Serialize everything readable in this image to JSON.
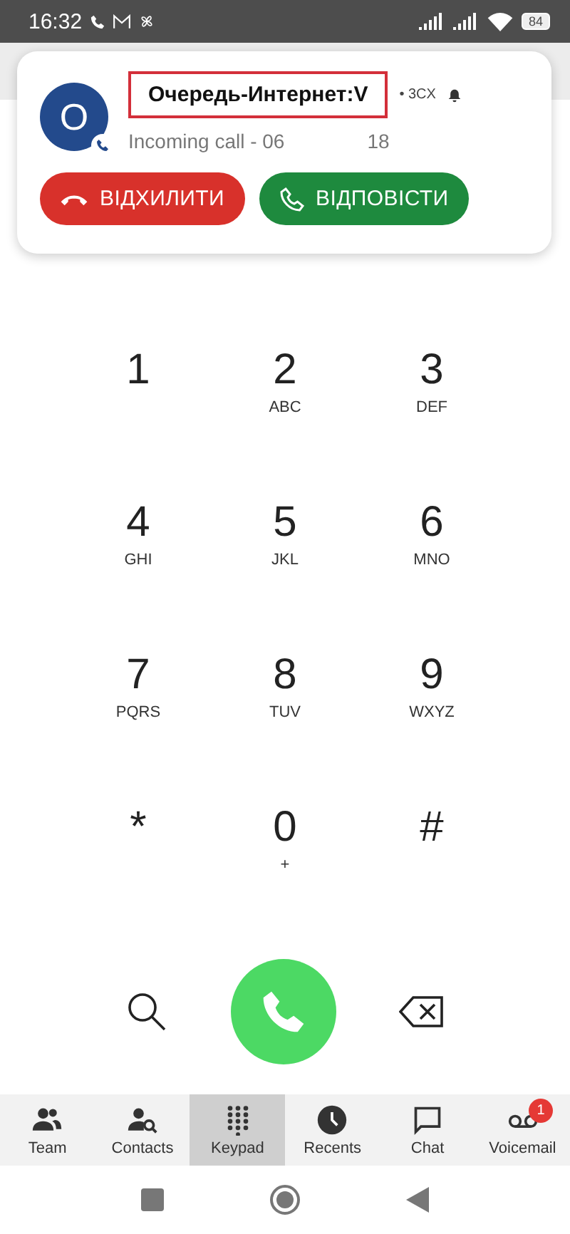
{
  "status_bar": {
    "time": "16:32",
    "battery": "84"
  },
  "notification": {
    "avatar_letter": "O",
    "caller": "Очередь-Интернет:V",
    "caller_highlighted": true,
    "app": "• 3CX",
    "line_start": "Incoming call - 06",
    "line_end": "18",
    "buttons": [
      {
        "kind": "decline",
        "label": "ВІДХИЛИТИ"
      },
      {
        "kind": "answer",
        "label": "ВІДПОВІСТИ"
      }
    ]
  },
  "keys": [
    {
      "digit": "1"
    },
    {
      "digit": "2",
      "letters": "ABC"
    },
    {
      "digit": "3",
      "letters": "DEF"
    },
    {
      "digit": "4",
      "letters": "GHI"
    },
    {
      "digit": "5",
      "letters": "JKL"
    },
    {
      "digit": "6",
      "letters": "MNO"
    },
    {
      "digit": "7",
      "letters": "PQRS"
    },
    {
      "digit": "8",
      "letters": "TUV"
    },
    {
      "digit": "9",
      "letters": "WXYZ"
    },
    {
      "digit": "*"
    },
    {
      "digit": "0",
      "letters": "+"
    },
    {
      "digit": "#"
    }
  ],
  "tabs": [
    {
      "kind": "team",
      "label": "Team",
      "selected": false
    },
    {
      "kind": "contacts",
      "label": "Contacts",
      "selected": false
    },
    {
      "kind": "keypad",
      "label": "Keypad",
      "selected": true
    },
    {
      "kind": "recents",
      "label": "Recents",
      "selected": false
    },
    {
      "kind": "chat",
      "label": "Chat",
      "selected": false
    },
    {
      "kind": "voicemail",
      "label": "Voicemail",
      "selected": false,
      "badge": "1"
    }
  ]
}
